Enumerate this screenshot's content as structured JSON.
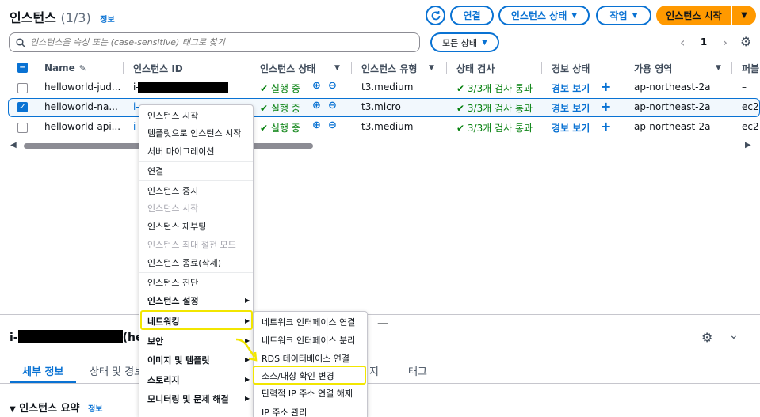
{
  "header": {
    "title": "인스턴스",
    "count": "(1/3)",
    "info": "정보",
    "connect": "연결",
    "instance_state": "인스턴스 상태",
    "actions": "작업",
    "launch": "인스턴스 시작"
  },
  "search": {
    "placeholder": "인스턴스을 속성 또는 (case-sensitive) 태그로 찾기",
    "state_filter": "모든 상태"
  },
  "pager": {
    "page": "1",
    "prev": "‹",
    "next": "›"
  },
  "columns": [
    "Name",
    "인스턴스 ID",
    "인스턴스 상태",
    "인스턴스 유형",
    "상태 검사",
    "경보 상태",
    "가용 영역",
    "퍼블"
  ],
  "rows": [
    {
      "name": "helloworld-jud...",
      "id_prefix": "i-",
      "state": "실행 중",
      "type": "t3.medium",
      "check": "3/3개 검사 통과",
      "alarm": "경보 보기",
      "az": "ap-northeast-2a",
      "public": "–",
      "selected": false
    },
    {
      "name": "helloworld-na...",
      "id_prefix": "i-",
      "state": "실행 중",
      "type": "t3.micro",
      "check": "3/3개 검사 통과",
      "alarm": "경보 보기",
      "az": "ap-northeast-2a",
      "public": "ec2",
      "selected": true
    },
    {
      "name": "helloworld-api...",
      "id_prefix": "i-",
      "state": "실행 중",
      "type": "t3.medium",
      "check": "3/3개 검사 통과",
      "alarm": "경보 보기",
      "az": "ap-northeast-2a",
      "public": "ec2",
      "selected": false
    }
  ],
  "context_menu": {
    "items": [
      {
        "label": "인스턴스 시작",
        "disabled": false,
        "bold": false
      },
      {
        "label": "템플릿으로 인스턴스 시작",
        "disabled": false,
        "bold": false
      },
      {
        "label": "서버 마이그레이션",
        "disabled": false,
        "bold": false
      },
      {
        "label": "연결",
        "disabled": false,
        "bold": false
      },
      {
        "label": "인스턴스 중지",
        "disabled": false,
        "bold": false
      },
      {
        "label": "인스턴스 시작",
        "disabled": true,
        "bold": false
      },
      {
        "label": "인스턴스 재부팅",
        "disabled": false,
        "bold": false
      },
      {
        "label": "인스턴스 최대 절전 모드",
        "disabled": true,
        "bold": false
      },
      {
        "label": "인스턴스 종료(삭제)",
        "disabled": false,
        "bold": false
      },
      {
        "label": "인스턴스 진단",
        "disabled": false,
        "bold": false
      },
      {
        "label": "인스턴스 설정",
        "disabled": false,
        "bold": true
      },
      {
        "label": "네트워킹",
        "disabled": false,
        "bold": true
      },
      {
        "label": "보안",
        "disabled": false,
        "bold": true
      },
      {
        "label": "이미지 및 템플릿",
        "disabled": false,
        "bold": true
      },
      {
        "label": "스토리지",
        "disabled": false,
        "bold": true
      },
      {
        "label": "모니터링 및 문제 해결",
        "disabled": false,
        "bold": true
      }
    ]
  },
  "networking_submenu": [
    "네트워크 인터페이스 연결",
    "네트워크 인터페이스 분리",
    "RDS 데이터베이스 연결",
    "소스/대상 확인 변경",
    "탄력적 IP 주소 연결 해제",
    "IP 주소 관리"
  ],
  "details": {
    "id_prefix": "i-",
    "id_suffix": "(he",
    "tabs": [
      "세부 정보",
      "상태 및 경보",
      "지",
      "태그"
    ],
    "summary": "인스턴스 요약",
    "summary_info": "정보"
  },
  "colors": {
    "accent": "#0972d3",
    "launch": "#ff9900",
    "success": "#037f0c",
    "highlight": "#f2e600"
  }
}
